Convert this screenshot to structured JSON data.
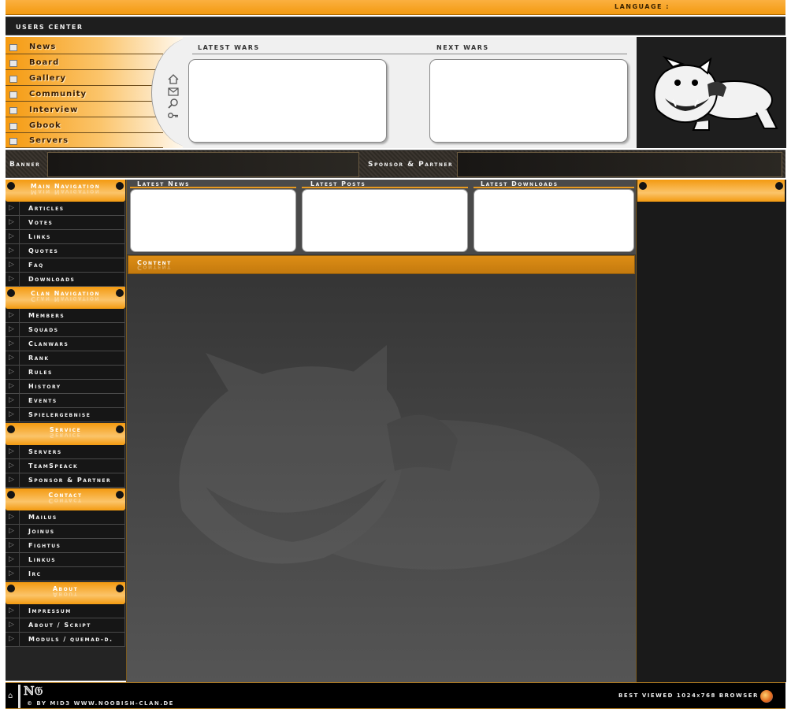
{
  "topbar": {
    "language_label": "LANGUAGE :"
  },
  "userbar": {
    "label": "USERS CENTER"
  },
  "header_nav": [
    "News",
    "Board",
    "Gallery",
    "Community",
    "Interview",
    "Gbook",
    "Servers"
  ],
  "header_icons": [
    "home-icon",
    "mail-icon",
    "search-icon",
    "key-icon"
  ],
  "wars": {
    "latest_label": "LATEST WARS",
    "next_label": "NEXT WARS"
  },
  "banner": {
    "banner_label": "Banner",
    "sponsor_label": "Sponsor & Partner"
  },
  "sections": {
    "main": {
      "title": "Main Navigation",
      "items": [
        "Articles",
        "Votes",
        "Links",
        "Quotes",
        "Faq",
        "Downloads"
      ]
    },
    "clan": {
      "title": "Clan Navigation",
      "items": [
        "Members",
        "Squads",
        "Clanwars",
        "Rank",
        "Rules",
        "History",
        "Events",
        "Spielergebnise"
      ]
    },
    "service": {
      "title": "Service",
      "items": [
        "Servers",
        "TeamSpeack",
        "Sponsor & Partner"
      ]
    },
    "contact": {
      "title": "Contact",
      "items": [
        "Mailus",
        "Joinus",
        "Fightus",
        "Linkus",
        "Irc"
      ]
    },
    "about": {
      "title": "About",
      "items": [
        "Impressum",
        "About / Script",
        "Moduls / quemad-d."
      ]
    }
  },
  "latest": {
    "news": "Latest News",
    "posts": "Latest Posts",
    "downloads": "Latest Downloads"
  },
  "content": {
    "title": "Content"
  },
  "footer": {
    "logo": "ℕ𝔊",
    "copyright": "© BY MID3  WWW.NOOBISH-CLAN.DE",
    "best_viewed": "BEST VIEWED 1024x768 BROWSER :"
  },
  "colors": {
    "accent": "#f39a10",
    "dark": "#1e1e1e",
    "panel": "#f0f0f0"
  }
}
